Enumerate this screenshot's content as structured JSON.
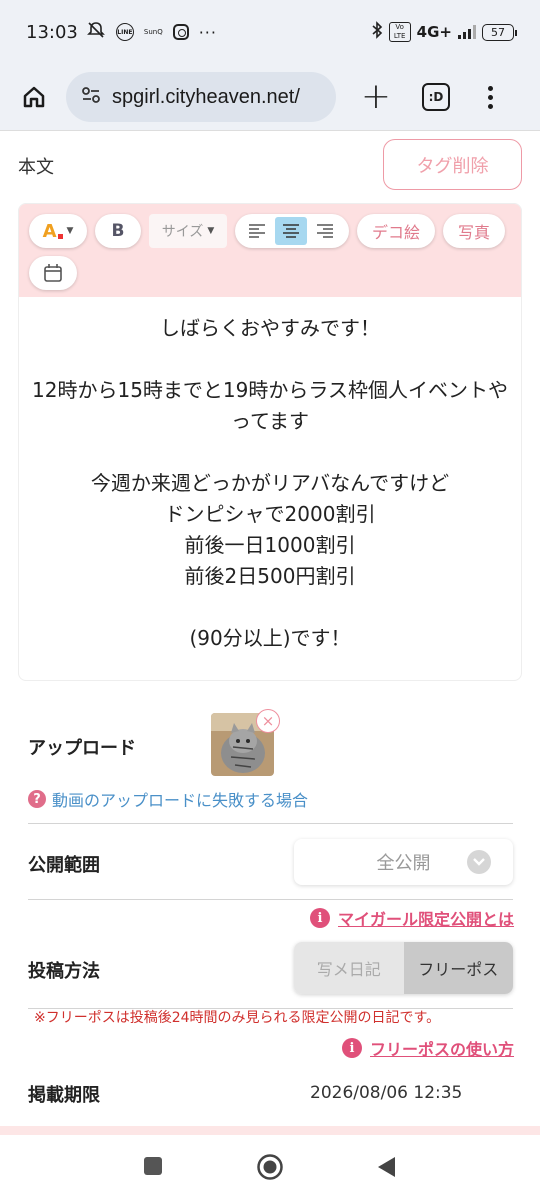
{
  "status_bar": {
    "time": "13:03",
    "network": "4G+",
    "battery": "57",
    "line_label": "LINE",
    "sunq_label": "SunQ",
    "volte_label": "Vo LTE",
    "more": "···"
  },
  "browser": {
    "url": "spgirl.cityheaven.net/",
    "tab_label": ":D"
  },
  "editor": {
    "label": "本文",
    "tag_delete_label": "タグ削除",
    "toolbar": {
      "color_button": "A",
      "bold_button": "B",
      "size_select": "サイズ",
      "deco_button": "デコ絵",
      "photo_button": "写真"
    },
    "content_lines": [
      "しばらくおやすみです！",
      "",
      "12時から15時までと19時からラス枠個人イベントやってます",
      "",
      "今週か来週どっかがリアバなんですけど",
      "ドンピシャで2000割引",
      "前後一日1000割引",
      "前後2日500円割引",
      "",
      "(90分以上)です！"
    ]
  },
  "upload": {
    "label": "アップロード",
    "fail_link": "動画のアップロードに失敗する場合"
  },
  "visibility": {
    "label": "公開範囲",
    "selected": "全公開",
    "info_link": "マイガール限定公開とは"
  },
  "post_method": {
    "label": "投稿方法",
    "options": [
      "写メ日記",
      "フリーポス"
    ],
    "selected": "フリーポス",
    "warning": "※フリーポスは投稿後24時間のみ見られる限定公開の日記です。",
    "info_link": "フリーポスの使い方"
  },
  "period": {
    "label": "掲載期限",
    "value": "2026/08/06 12:35"
  },
  "colors": {
    "accent_pink": "#e0507a",
    "toolbar_bg": "#fde0e1",
    "link_blue": "#4a90c8",
    "warning_red": "#d0302d"
  }
}
